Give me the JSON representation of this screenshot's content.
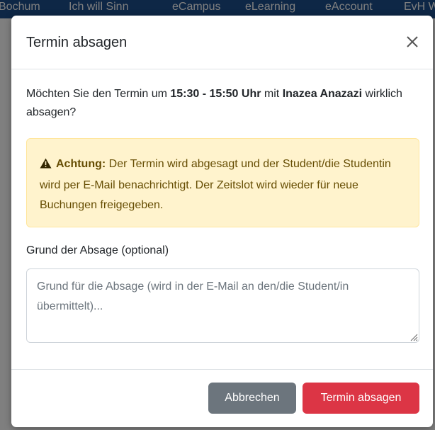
{
  "background": {
    "nav_items": [
      "Bochum",
      "Ich will Sinn",
      "eCampus",
      "eLearning",
      "eAccount",
      "EvH We"
    ]
  },
  "modal": {
    "title": "Termin absagen",
    "close_icon": "close-icon",
    "question": {
      "prefix": "Möchten Sie den Termin um",
      "time_start": "15:30",
      "dash": "-",
      "time_end": "15:50 Uhr",
      "with": "mit",
      "person": "Inazea Anazazi",
      "suffix": "wirklich absagen?"
    },
    "alert": {
      "icon": "warning-triangle-icon",
      "heading": "Achtung:",
      "text": "Der Termin wird abgesagt und der Student/die Studentin wird per E-Mail benachrichtigt. Der Zeitslot wird wieder für neue Buchungen freigegeben."
    },
    "reason": {
      "label": "Grund der Absage (optional)",
      "value": "",
      "placeholder": "Grund für die Absage (wird in der E-Mail an den/die Student/in übermittelt)..."
    },
    "buttons": {
      "cancel": "Abbrechen",
      "confirm": "Termin absagen"
    }
  },
  "colors": {
    "danger": "#dc3545",
    "secondary": "#6c757d",
    "warning_bg": "#fff3cd",
    "warning_text": "#664d03"
  }
}
